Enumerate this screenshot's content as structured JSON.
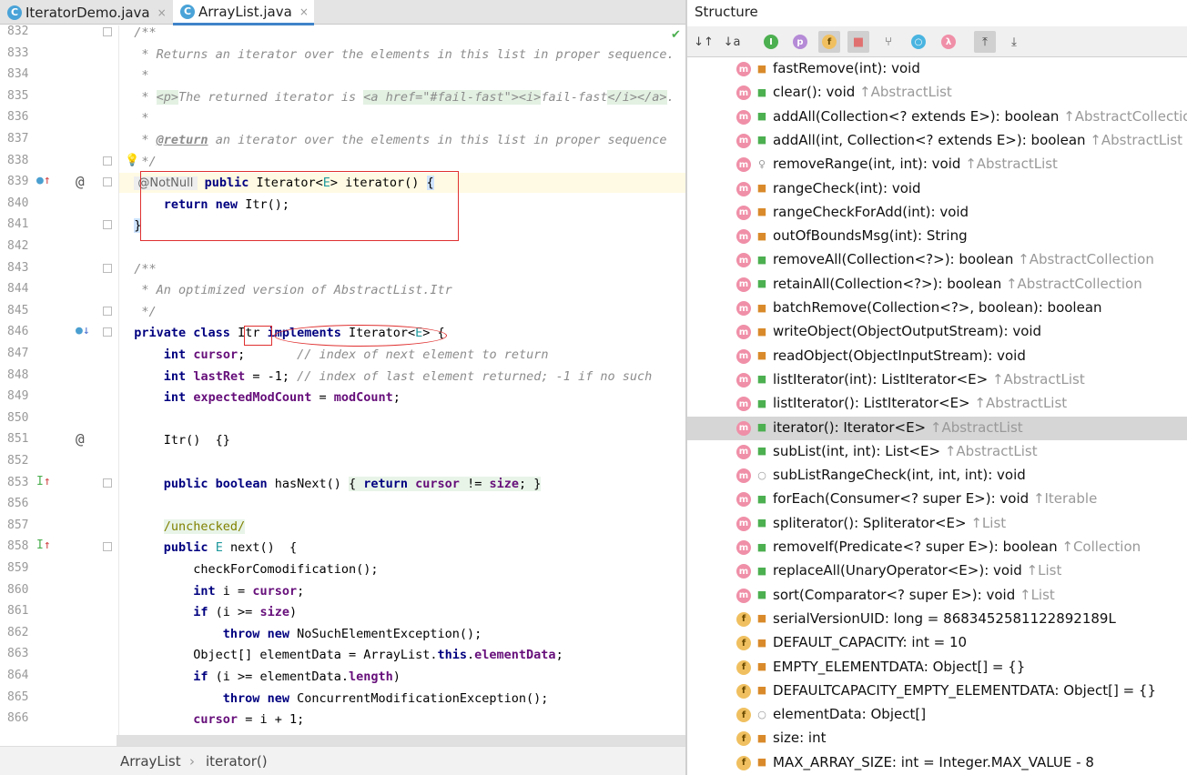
{
  "tabs": [
    {
      "label": "IteratorDemo.java",
      "close": "×",
      "icon": "c-class-icon"
    },
    {
      "label": "ArrayList.java",
      "close": "×",
      "icon": "c-class-icon"
    }
  ],
  "editor": {
    "line_numbers": [
      "832",
      "833",
      "834",
      "835",
      "836",
      "837",
      "838",
      "839",
      "840",
      "841",
      "842",
      "843",
      "844",
      "845",
      "846",
      "847",
      "848",
      "849",
      "850",
      "851",
      "852",
      "853",
      "856",
      "857",
      "858",
      "859",
      "860",
      "861",
      "862",
      "863",
      "864",
      "865",
      "866"
    ],
    "breadcrumb": [
      "ArrayList",
      "›",
      "iterator()"
    ]
  },
  "structure": {
    "title": "Structure",
    "toolbar": [
      "sort-visibility",
      "sort-alpha",
      "show-inherited",
      "show-properties",
      "show-fields",
      "show-non-public",
      "show-anonymous",
      "show-lambdas",
      "autoscroll-to-source",
      "autoscroll-from-source"
    ],
    "items": [
      {
        "kind": "m",
        "vis": "priv",
        "name": "fastRemove(int): void",
        "inherited": ""
      },
      {
        "kind": "m",
        "vis": "pub",
        "name": "clear(): void ",
        "inherited": "↑AbstractList"
      },
      {
        "kind": "m",
        "vis": "pub",
        "name": "addAll(Collection<? extends E>): boolean ",
        "inherited": "↑AbstractCollection"
      },
      {
        "kind": "m",
        "vis": "pub",
        "name": "addAll(int, Collection<? extends E>): boolean ",
        "inherited": "↑AbstractList"
      },
      {
        "kind": "m",
        "vis": "prot",
        "name": "removeRange(int, int): void ",
        "inherited": "↑AbstractList"
      },
      {
        "kind": "m",
        "vis": "priv",
        "name": "rangeCheck(int): void",
        "inherited": ""
      },
      {
        "kind": "m",
        "vis": "priv",
        "name": "rangeCheckForAdd(int): void",
        "inherited": ""
      },
      {
        "kind": "m",
        "vis": "priv",
        "name": "outOfBoundsMsg(int): String",
        "inherited": ""
      },
      {
        "kind": "m",
        "vis": "pub",
        "name": "removeAll(Collection<?>): boolean ",
        "inherited": "↑AbstractCollection"
      },
      {
        "kind": "m",
        "vis": "pub",
        "name": "retainAll(Collection<?>): boolean ",
        "inherited": "↑AbstractCollection"
      },
      {
        "kind": "m",
        "vis": "priv",
        "name": "batchRemove(Collection<?>, boolean): boolean",
        "inherited": ""
      },
      {
        "kind": "m",
        "vis": "priv",
        "name": "writeObject(ObjectOutputStream): void",
        "inherited": ""
      },
      {
        "kind": "m",
        "vis": "priv",
        "name": "readObject(ObjectInputStream): void",
        "inherited": ""
      },
      {
        "kind": "m",
        "vis": "pub",
        "name": "listIterator(int): ListIterator<E> ",
        "inherited": "↑AbstractList"
      },
      {
        "kind": "m",
        "vis": "pub",
        "name": "listIterator(): ListIterator<E> ",
        "inherited": "↑AbstractList"
      },
      {
        "kind": "m",
        "vis": "pub",
        "name": "iterator(): Iterator<E> ",
        "inherited": "↑AbstractList",
        "selected": true
      },
      {
        "kind": "m",
        "vis": "pub",
        "name": "subList(int, int): List<E> ",
        "inherited": "↑AbstractList"
      },
      {
        "kind": "m",
        "vis": "pkg",
        "name": "subListRangeCheck(int, int, int): void",
        "inherited": ""
      },
      {
        "kind": "m",
        "vis": "pub",
        "name": "forEach(Consumer<? super E>): void ",
        "inherited": "↑Iterable"
      },
      {
        "kind": "m",
        "vis": "pub",
        "name": "spliterator(): Spliterator<E> ",
        "inherited": "↑List"
      },
      {
        "kind": "m",
        "vis": "pub",
        "name": "removeIf(Predicate<? super E>): boolean ",
        "inherited": "↑Collection"
      },
      {
        "kind": "m",
        "vis": "pub",
        "name": "replaceAll(UnaryOperator<E>): void ",
        "inherited": "↑List"
      },
      {
        "kind": "m",
        "vis": "pub",
        "name": "sort(Comparator<? super E>): void ",
        "inherited": "↑List"
      },
      {
        "kind": "f",
        "vis": "priv",
        "name": "serialVersionUID: long = 8683452581122892189L",
        "inherited": ""
      },
      {
        "kind": "f",
        "vis": "priv",
        "name": "DEFAULT_CAPACITY: int = 10",
        "inherited": ""
      },
      {
        "kind": "f",
        "vis": "priv",
        "name": "EMPTY_ELEMENTDATA: Object[] = {}",
        "inherited": ""
      },
      {
        "kind": "f",
        "vis": "priv",
        "name": "DEFAULTCAPACITY_EMPTY_ELEMENTDATA: Object[] = {}",
        "inherited": ""
      },
      {
        "kind": "f",
        "vis": "pkg",
        "name": "elementData: Object[]",
        "inherited": ""
      },
      {
        "kind": "f",
        "vis": "priv",
        "name": "size: int",
        "inherited": ""
      },
      {
        "kind": "f",
        "vis": "priv",
        "name": "MAX_ARRAY_SIZE: int = Integer.MAX_VALUE - 8",
        "inherited": ""
      }
    ]
  }
}
